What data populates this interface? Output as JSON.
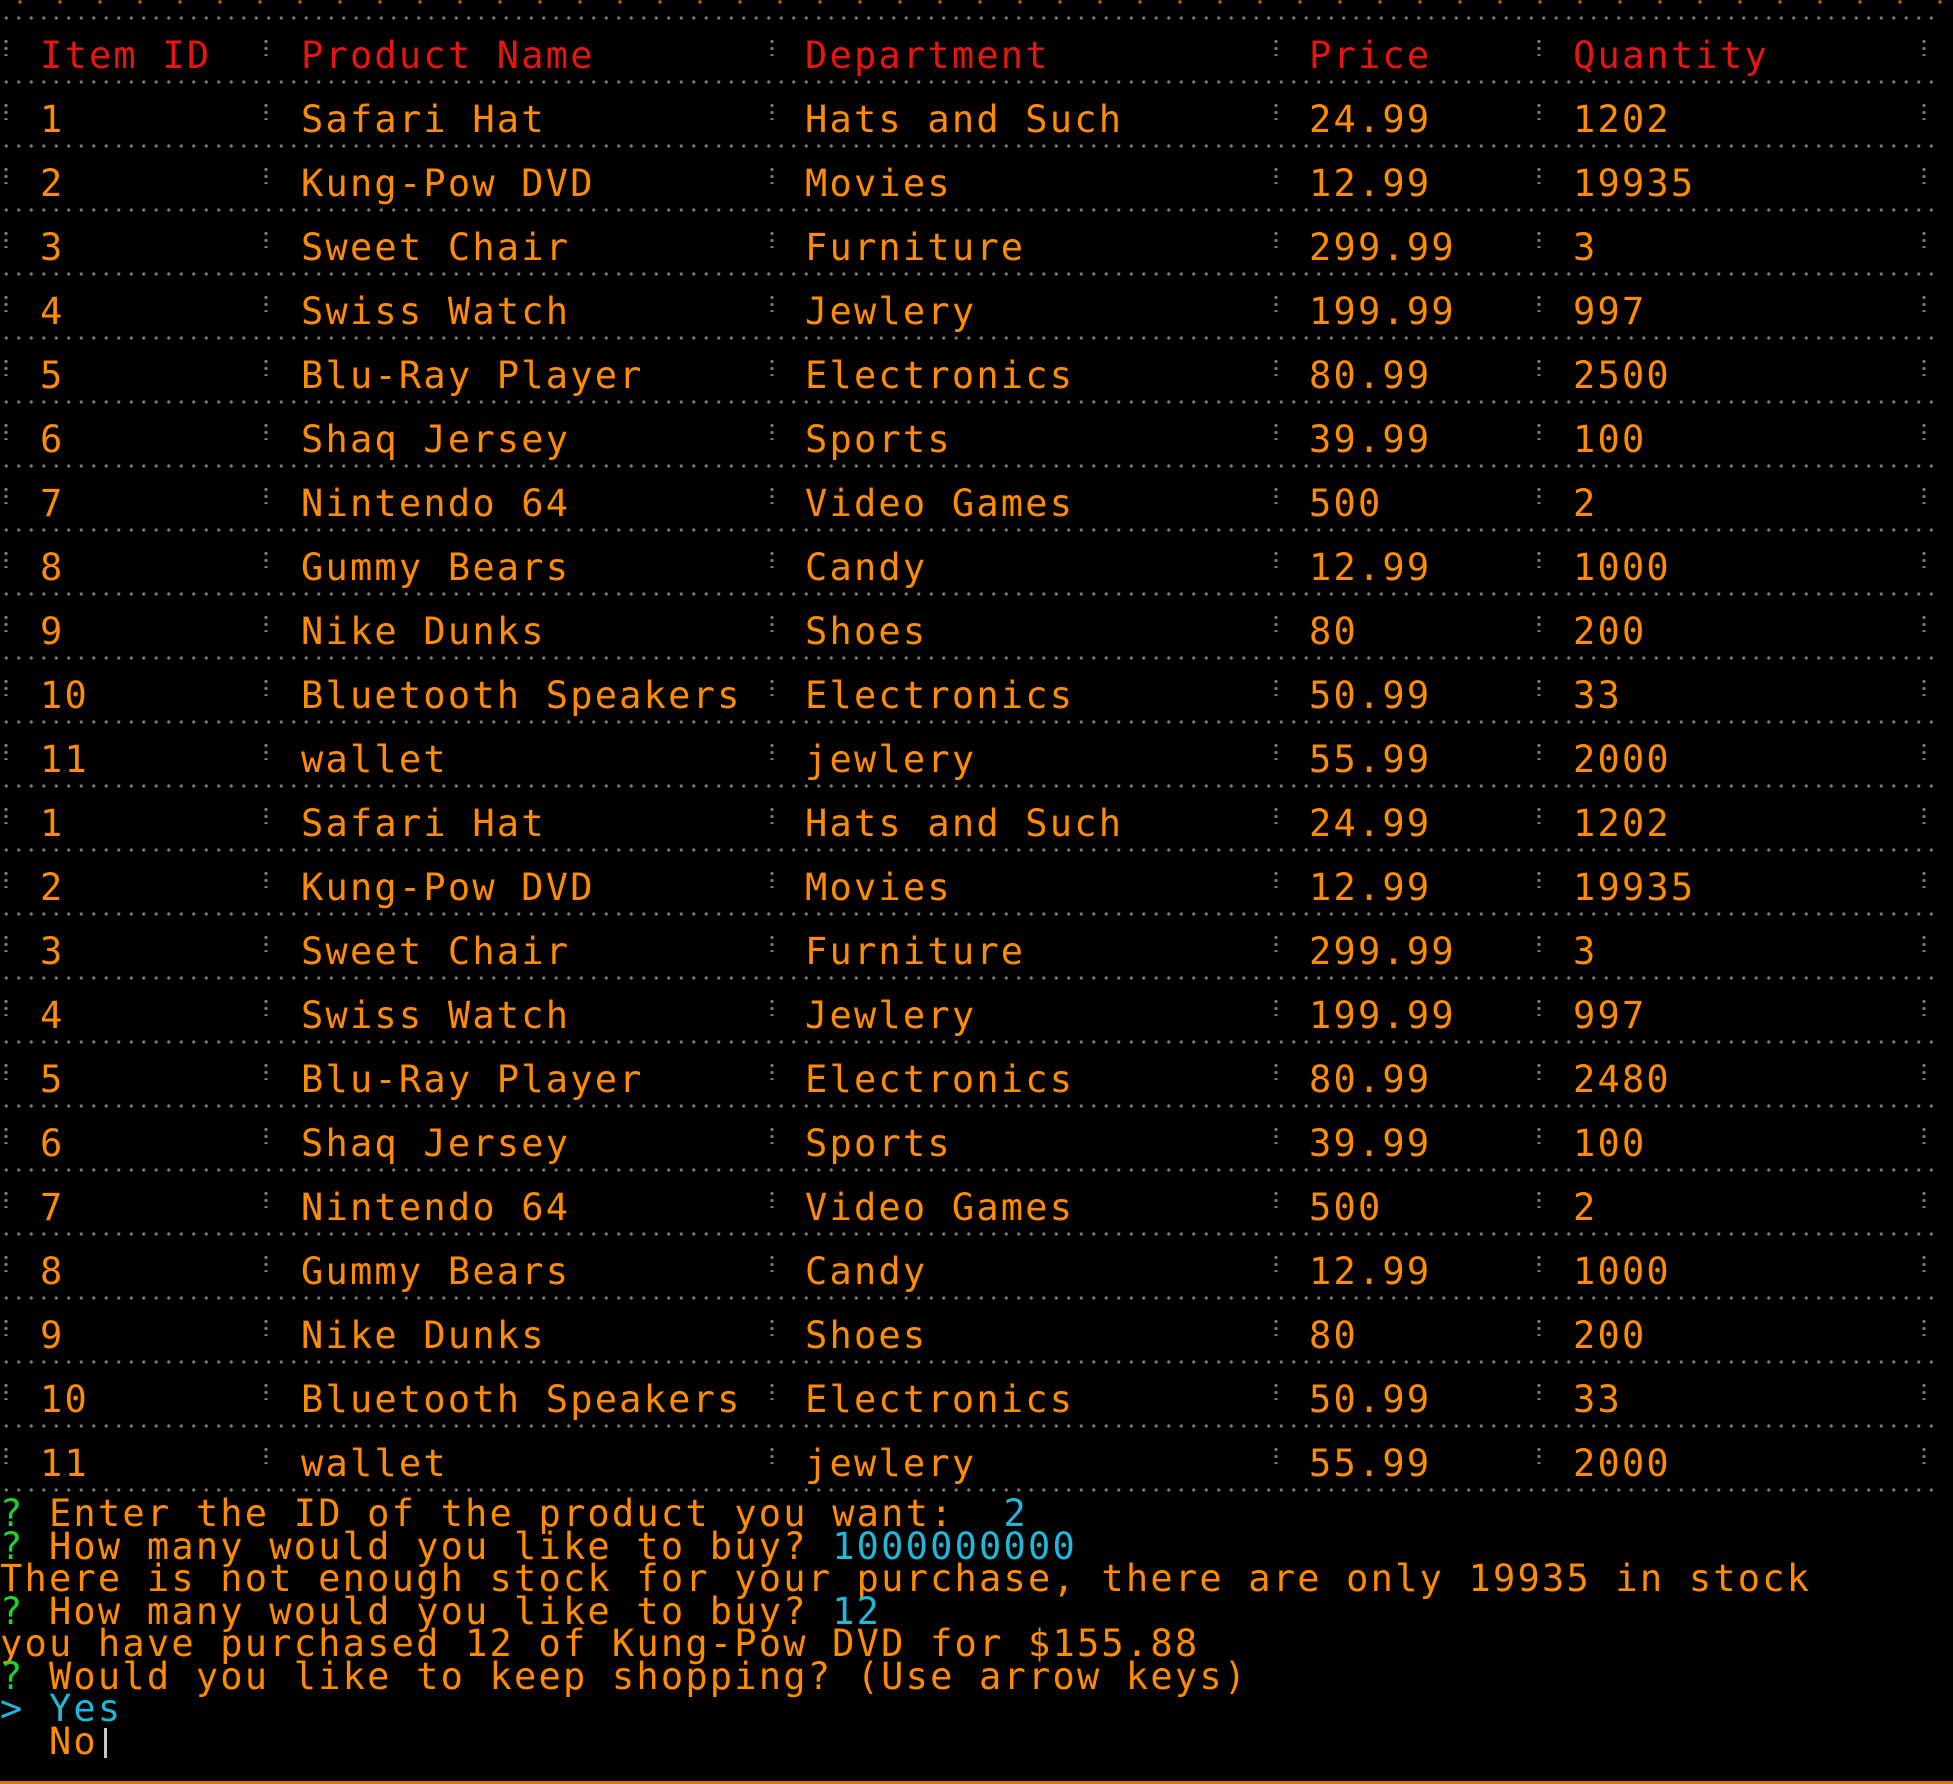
{
  "table": {
    "headers": [
      "Item ID",
      "Product Name",
      "Department",
      "Price",
      "Quantity"
    ],
    "rows": [
      [
        "1",
        "Safari Hat",
        "Hats and Such",
        "24.99",
        "1202"
      ],
      [
        "2",
        "Kung-Pow DVD",
        "Movies",
        "12.99",
        "19935"
      ],
      [
        "3",
        "Sweet Chair",
        "Furniture",
        "299.99",
        "3"
      ],
      [
        "4",
        "Swiss Watch",
        "Jewlery",
        "199.99",
        "997"
      ],
      [
        "5",
        "Blu-Ray Player",
        "Electronics",
        "80.99",
        "2500"
      ],
      [
        "6",
        "Shaq Jersey",
        "Sports",
        "39.99",
        "100"
      ],
      [
        "7",
        "Nintendo 64",
        "Video Games",
        "500",
        "2"
      ],
      [
        "8",
        "Gummy Bears",
        "Candy",
        "12.99",
        "1000"
      ],
      [
        "9",
        "Nike Dunks",
        "Shoes",
        "80",
        "200"
      ],
      [
        "10",
        "Bluetooth Speakers",
        "Electronics",
        "50.99",
        "33"
      ],
      [
        "11",
        "wallet",
        "jewlery",
        "55.99",
        "2000"
      ],
      [
        "1",
        "Safari Hat",
        "Hats and Such",
        "24.99",
        "1202"
      ],
      [
        "2",
        "Kung-Pow DVD",
        "Movies",
        "12.99",
        "19935"
      ],
      [
        "3",
        "Sweet Chair",
        "Furniture",
        "299.99",
        "3"
      ],
      [
        "4",
        "Swiss Watch",
        "Jewlery",
        "199.99",
        "997"
      ],
      [
        "5",
        "Blu-Ray Player",
        "Electronics",
        "80.99",
        "2480"
      ],
      [
        "6",
        "Shaq Jersey",
        "Sports",
        "39.99",
        "100"
      ],
      [
        "7",
        "Nintendo 64",
        "Video Games",
        "500",
        "2"
      ],
      [
        "8",
        "Gummy Bears",
        "Candy",
        "12.99",
        "1000"
      ],
      [
        "9",
        "Nike Dunks",
        "Shoes",
        "80",
        "200"
      ],
      [
        "10",
        "Bluetooth Speakers",
        "Electronics",
        "50.99",
        "33"
      ],
      [
        "11",
        "wallet",
        "jewlery",
        "55.99",
        "2000"
      ]
    ]
  },
  "prompts": {
    "q1_mark": "?",
    "q1_text": " Enter the ID of the product you want:  ",
    "q1_answer": "2",
    "q2_mark": "?",
    "q2_text": " How many would you like to buy? ",
    "q2_answer": "1000000000",
    "error_text": "There is not enough stock for your purchase, there are only 19935 in stock",
    "q3_mark": "?",
    "q3_text": " How many would you like to buy? ",
    "q3_answer": "12",
    "purchase_text": "you have purchased 12 of Kung-Pow DVD for $155.88",
    "q4_mark": "?",
    "q4_text": " Would you like to keep shopping? (Use arrow keys)",
    "choice_pointer": ">",
    "choice_yes": " Yes",
    "choice_no": "  No"
  },
  "colors": {
    "background": "#000000",
    "header_text": "#e8140f",
    "body_text": "#ff8c00",
    "question_mark": "#22d22c",
    "answer_text": "#20b8d8",
    "border_dots": "#7a7a7a"
  }
}
